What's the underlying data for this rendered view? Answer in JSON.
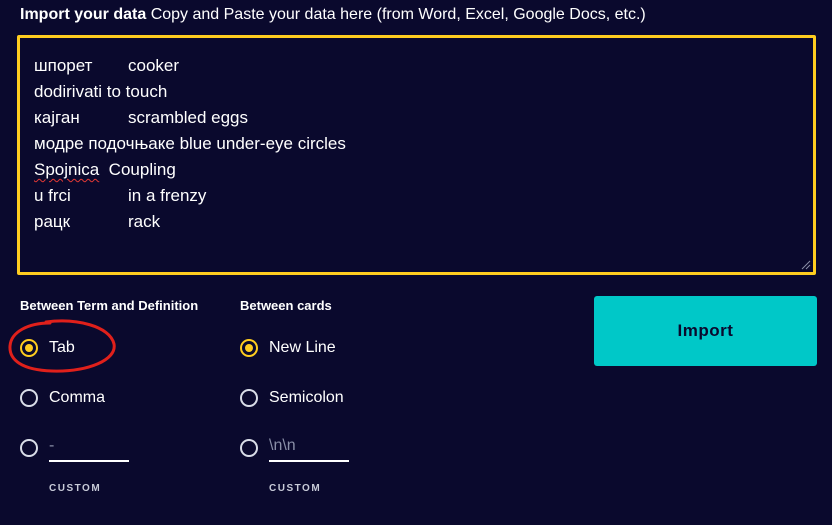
{
  "header": {
    "title": "Import your data",
    "subtitle": "Copy and Paste your data here (from Word, Excel, Google Docs, etc.)"
  },
  "textarea": {
    "rows": [
      {
        "term": "шпорет",
        "definition": "cooker"
      },
      {
        "term": "dodirivati",
        "definition": "to touch"
      },
      {
        "term": "кајган",
        "definition": "scrambled eggs"
      },
      {
        "term": "модре подочњаке",
        "definition": "blue under-eye circles"
      },
      {
        "term": "Spojnica",
        "definition": "Coupling"
      },
      {
        "term": "u frci",
        "definition": "in a frenzy"
      },
      {
        "term": "рацк",
        "definition": "rack"
      }
    ]
  },
  "term_definition": {
    "title": "Between Term and Definition",
    "options": [
      {
        "label": "Tab",
        "selected": true
      },
      {
        "label": "Comma",
        "selected": false
      }
    ],
    "custom": {
      "placeholder": "-",
      "caption": "CUSTOM"
    }
  },
  "between_cards": {
    "title": "Between cards",
    "options": [
      {
        "label": "New Line",
        "selected": true
      },
      {
        "label": "Semicolon",
        "selected": false
      }
    ],
    "custom": {
      "placeholder": "\\n\\n",
      "caption": "CUSTOM"
    }
  },
  "import_button": {
    "label": "Import"
  },
  "colors": {
    "background": "#0a092d",
    "accent_yellow": "#ffcd1f",
    "import_button": "#00c8c8",
    "annotation_red": "#e0201b"
  }
}
